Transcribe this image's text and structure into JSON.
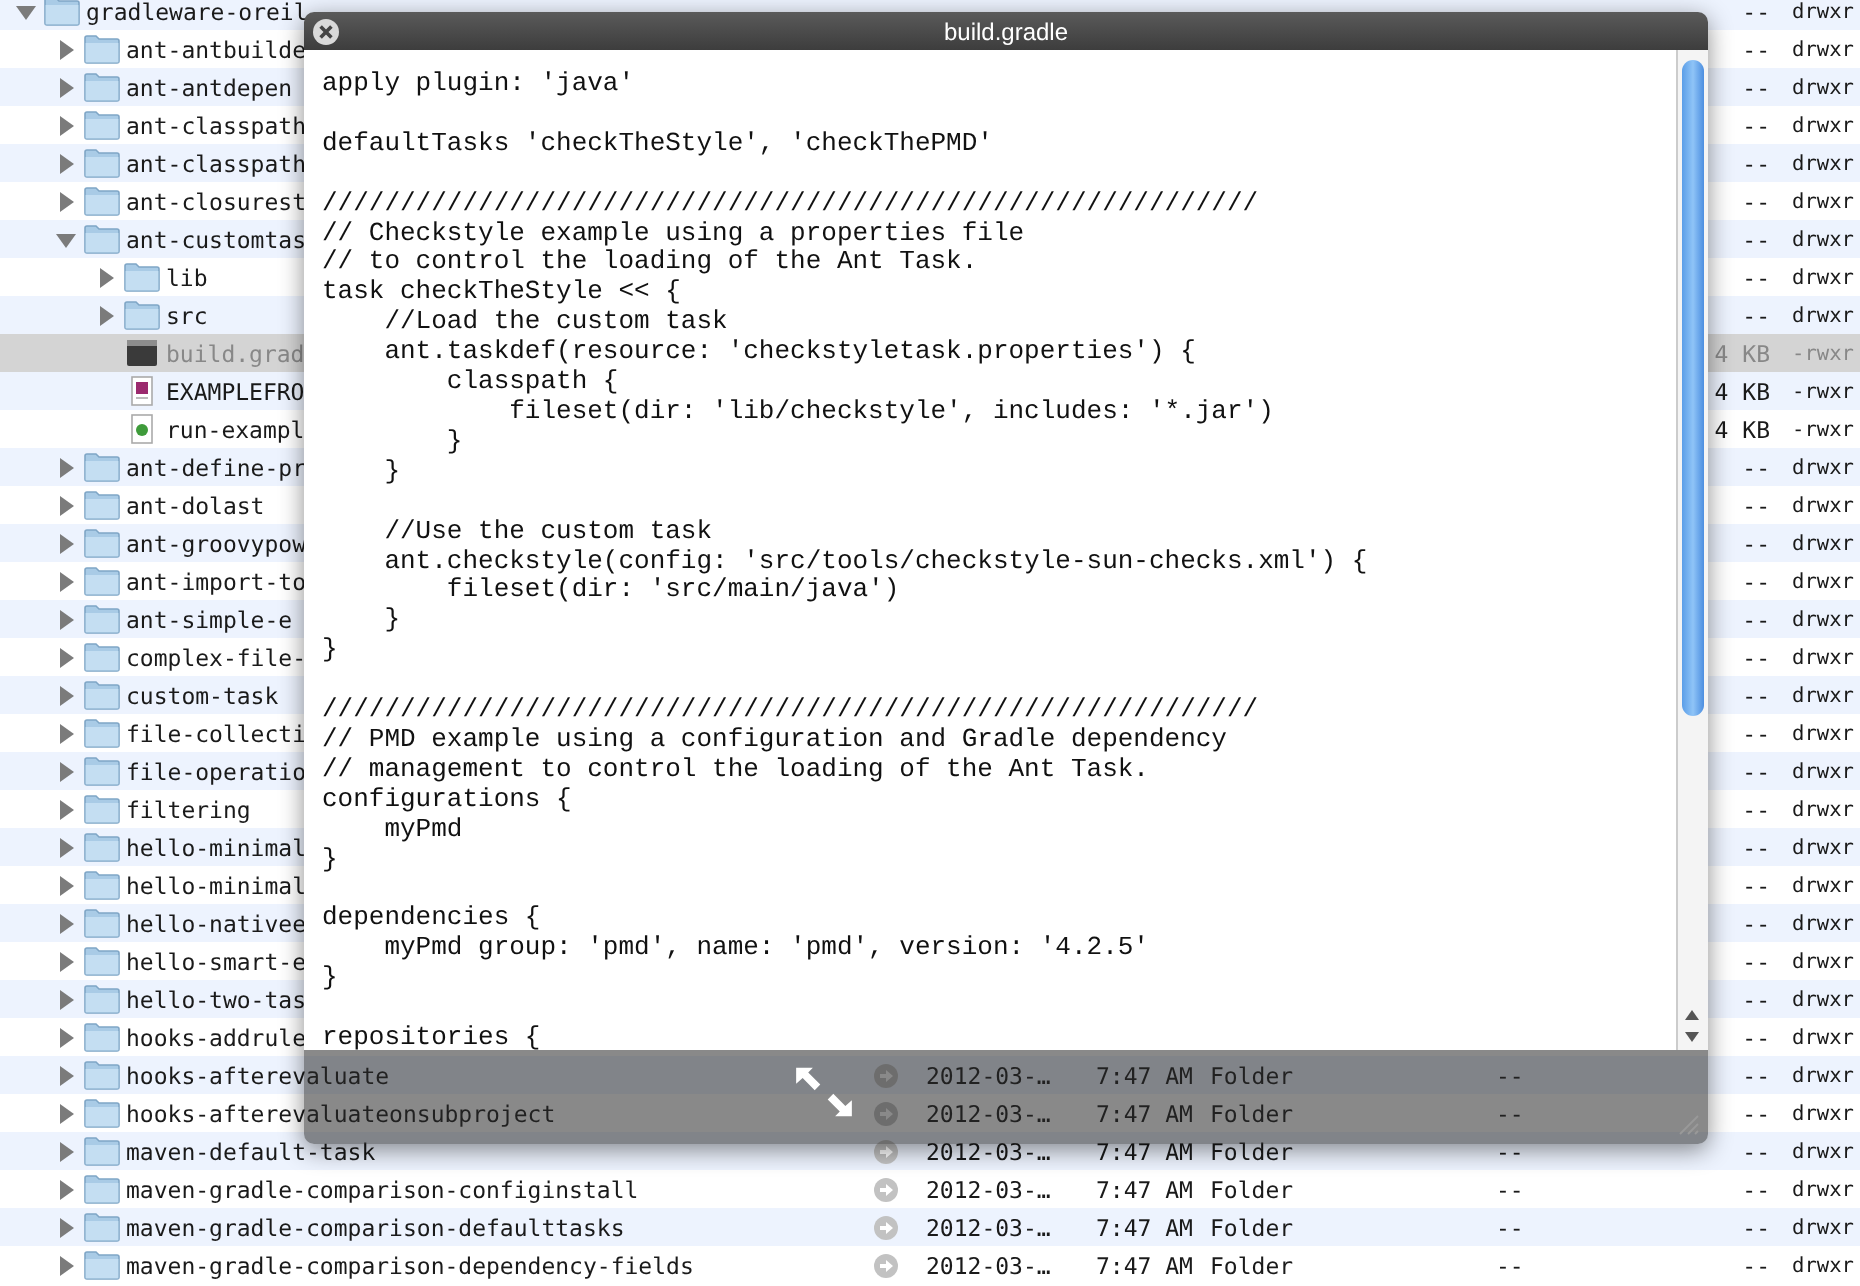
{
  "finder": {
    "rows": [
      {
        "name": "gradleware-oreil",
        "kind": "folder",
        "expanded": true,
        "selected": false,
        "size": "--",
        "permissions": "drwxr",
        "children": [
          {
            "name": "ant-antbuilde",
            "kind": "folder",
            "expanded": false,
            "selected": false,
            "size": "--",
            "permissions": "drwxr"
          },
          {
            "name": "ant-antdepen",
            "kind": "folder",
            "expanded": false,
            "selected": false,
            "size": "--",
            "permissions": "drwxr"
          },
          {
            "name": "ant-classpath",
            "kind": "folder",
            "expanded": false,
            "selected": false,
            "size": "--",
            "permissions": "drwxr"
          },
          {
            "name": "ant-classpath",
            "kind": "folder",
            "expanded": false,
            "selected": false,
            "size": "--",
            "permissions": "drwxr"
          },
          {
            "name": "ant-closurest",
            "kind": "folder",
            "expanded": false,
            "selected": false,
            "size": "--",
            "permissions": "drwxr"
          },
          {
            "name": "ant-customtas",
            "kind": "folder",
            "expanded": true,
            "selected": false,
            "size": "--",
            "permissions": "drwxr",
            "children": [
              {
                "name": "lib",
                "kind": "folder",
                "expanded": false,
                "selected": false,
                "size": "--",
                "permissions": "drwxr"
              },
              {
                "name": "src",
                "kind": "folder",
                "expanded": false,
                "selected": false,
                "size": "--",
                "permissions": "drwxr"
              },
              {
                "name": "build.grad",
                "kind": "gradle",
                "selected": true,
                "size": "4 KB",
                "permissions": "-rwxr"
              },
              {
                "name": "EXAMPLEFRO",
                "kind": "pdf",
                "selected": false,
                "size": "4 KB",
                "permissions": "-rwxr"
              },
              {
                "name": "run-exampl",
                "kind": "script",
                "selected": false,
                "size": "4 KB",
                "permissions": "-rwxr"
              }
            ]
          },
          {
            "name": "ant-define-pr",
            "kind": "folder",
            "expanded": false,
            "selected": false,
            "size": "--",
            "permissions": "drwxr"
          },
          {
            "name": "ant-dolast",
            "kind": "folder",
            "expanded": false,
            "selected": false,
            "size": "--",
            "permissions": "drwxr"
          },
          {
            "name": "ant-groovypow",
            "kind": "folder",
            "expanded": false,
            "selected": false,
            "size": "--",
            "permissions": "drwxr"
          },
          {
            "name": "ant-import-to",
            "kind": "folder",
            "expanded": false,
            "selected": false,
            "size": "--",
            "permissions": "drwxr"
          },
          {
            "name": "ant-simple-e",
            "kind": "folder",
            "expanded": false,
            "selected": false,
            "size": "--",
            "permissions": "drwxr"
          },
          {
            "name": "complex-file-",
            "kind": "folder",
            "expanded": false,
            "selected": false,
            "size": "--",
            "permissions": "drwxr"
          },
          {
            "name": "custom-task",
            "kind": "folder",
            "expanded": false,
            "selected": false,
            "size": "--",
            "permissions": "drwxr"
          },
          {
            "name": "file-collecti",
            "kind": "folder",
            "expanded": false,
            "selected": false,
            "size": "--",
            "permissions": "drwxr"
          },
          {
            "name": "file-operatio",
            "kind": "folder",
            "expanded": false,
            "selected": false,
            "size": "--",
            "permissions": "drwxr"
          },
          {
            "name": "filtering",
            "kind": "folder",
            "expanded": false,
            "selected": false,
            "size": "--",
            "permissions": "drwxr"
          },
          {
            "name": "hello-minimal",
            "kind": "folder",
            "expanded": false,
            "selected": false,
            "size": "--",
            "permissions": "drwxr"
          },
          {
            "name": "hello-minimal",
            "kind": "folder",
            "expanded": false,
            "selected": false,
            "size": "--",
            "permissions": "drwxr"
          },
          {
            "name": "hello-nativee",
            "kind": "folder",
            "expanded": false,
            "selected": false,
            "size": "--",
            "permissions": "drwxr"
          },
          {
            "name": "hello-smart-e",
            "kind": "folder",
            "expanded": false,
            "selected": false,
            "size": "--",
            "permissions": "drwxr"
          },
          {
            "name": "hello-two-tas",
            "kind": "folder",
            "expanded": false,
            "selected": false,
            "size": "--",
            "permissions": "drwxr"
          },
          {
            "name": "hooks-addrule",
            "kind": "folder",
            "expanded": false,
            "selected": false,
            "size": "--",
            "permissions": "drwxr"
          },
          {
            "name": "hooks-afterevaluate",
            "kind": "folder",
            "expanded": false,
            "selected": false,
            "date": "2012-03-…",
            "time": "7:47 AM",
            "file_kind": "Folder",
            "column_5": "--",
            "size": "--",
            "permissions": "drwxr"
          },
          {
            "name": "hooks-afterevaluateonsubproject",
            "kind": "folder",
            "expanded": false,
            "selected": false,
            "date": "2012-03-…",
            "time": "7:47 AM",
            "file_kind": "Folder",
            "column_5": "--",
            "size": "--",
            "permissions": "drwxr"
          },
          {
            "name": "maven-default-task",
            "kind": "folder",
            "expanded": false,
            "selected": false,
            "date": "2012-03-…",
            "time": "7:47 AM",
            "file_kind": "Folder",
            "column_5": "--",
            "size": "--",
            "permissions": "drwxr"
          },
          {
            "name": "maven-gradle-comparison-configinstall",
            "kind": "folder",
            "expanded": false,
            "selected": false,
            "date": "2012-03-…",
            "time": "7:47 AM",
            "file_kind": "Folder",
            "column_5": "--",
            "size": "--",
            "permissions": "drwxr"
          },
          {
            "name": "maven-gradle-comparison-defaulttasks",
            "kind": "folder",
            "expanded": false,
            "selected": false,
            "date": "2012-03-…",
            "time": "7:47 AM",
            "file_kind": "Folder",
            "column_5": "--",
            "size": "--",
            "permissions": "drwxr"
          },
          {
            "name": "maven-gradle-comparison-dependency-fields",
            "kind": "folder",
            "expanded": false,
            "selected": false,
            "date": "2012-03-…",
            "time": "7:47 AM",
            "file_kind": "Folder",
            "column_5": "--",
            "size": "--",
            "permissions": "drwxr"
          }
        ]
      }
    ]
  },
  "quicklook": {
    "title": "build.gradle",
    "code": "apply plugin: 'java'\n\ndefaultTasks 'checkTheStyle', 'checkThePMD'\n\n////////////////////////////////////////////////////////////\n// Checkstyle example using a properties file\n// to control the loading of the Ant Task.\ntask checkTheStyle << {\n    //Load the custom task\n    ant.taskdef(resource: 'checkstyletask.properties') {\n        classpath {\n            fileset(dir: 'lib/checkstyle', includes: '*.jar')\n        }\n    }\n\n    //Use the custom task\n    ant.checkstyle(config: 'src/tools/checkstyle-sun-checks.xml') {\n        fileset(dir: 'src/main/java')\n    }\n}\n\n////////////////////////////////////////////////////////////\n// PMD example using a configuration and Gradle dependency\n// management to control the loading of the Ant Task.\nconfigurations {\n    myPmd\n}\n\ndependencies {\n    myPmd group: 'pmd', name: 'pmd', version: '4.2.5'\n}\n\nrepositories {"
  }
}
